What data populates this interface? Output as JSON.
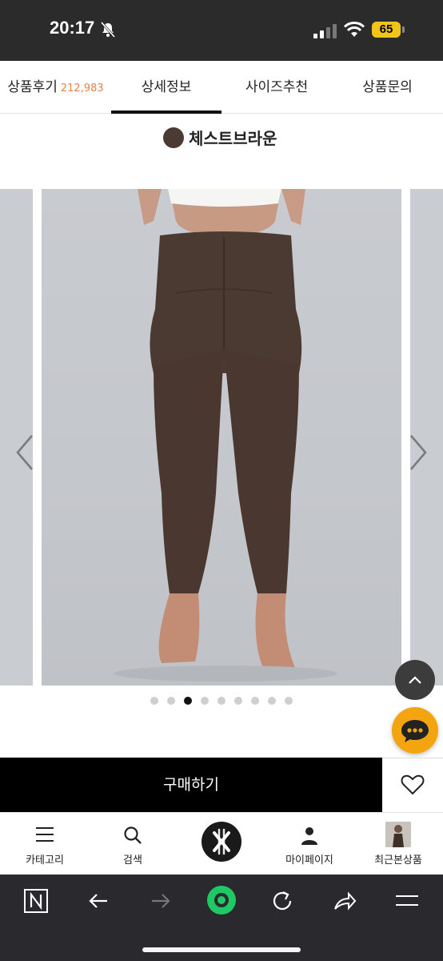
{
  "status_bar": {
    "time": "20:17",
    "battery": "65"
  },
  "tabs": [
    {
      "label": "상품후기",
      "count": "212,983"
    },
    {
      "label": "상세정보"
    },
    {
      "label": "사이즈추천"
    },
    {
      "label": "상품문의"
    }
  ],
  "active_tab": "상세정보",
  "product": {
    "color_name": "체스트브라운",
    "color_hex": "#4a3a33"
  },
  "carousel": {
    "dot_count": 9,
    "active_dot": 3
  },
  "buy": {
    "label": "구매하기"
  },
  "bottom_nav": {
    "category": "카테고리",
    "search": "검색",
    "mypage": "마이페이지",
    "recent": "최근본상품"
  },
  "colors": {
    "accent": "#e8804a",
    "chat": "#f4a40f"
  }
}
